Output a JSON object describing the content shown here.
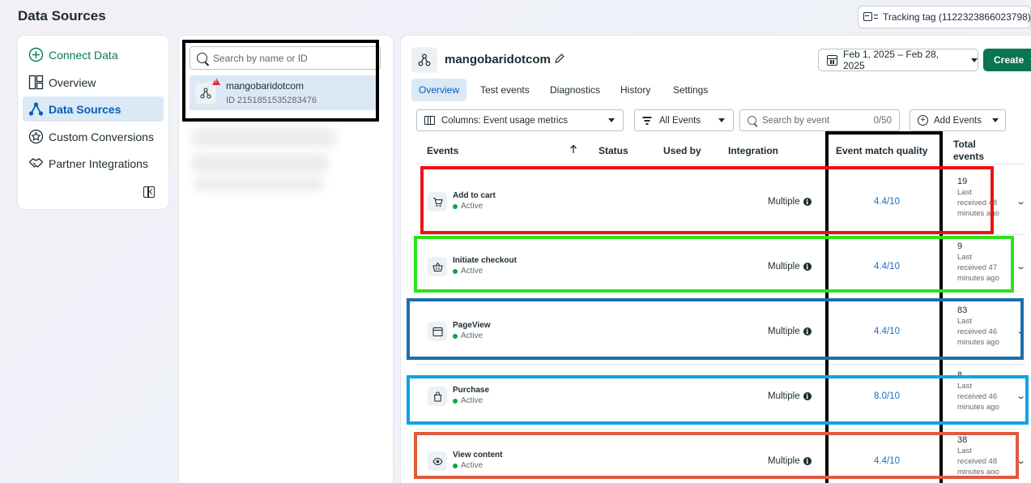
{
  "page": {
    "title": "Data Sources"
  },
  "tracking_tag": {
    "label": "Tracking tag (1122323866023798)"
  },
  "nav": {
    "items": [
      {
        "label": "Connect Data",
        "icon": "plus-circle-icon"
      },
      {
        "label": "Overview",
        "icon": "overview-grid-icon"
      },
      {
        "label": "Data Sources",
        "icon": "data-sources-icon",
        "selected": true
      },
      {
        "label": "Custom Conversions",
        "icon": "star-badge-icon"
      },
      {
        "label": "Partner Integrations",
        "icon": "handshake-icon"
      }
    ]
  },
  "source_list": {
    "search_placeholder": "Search by name or ID",
    "items": [
      {
        "name": "mangobaridotcom",
        "id": "ID 2151851535283476",
        "warning": true
      }
    ]
  },
  "main": {
    "title": "mangobaridotcom",
    "date_range": "Feb 1, 2025 – Feb 28, 2025",
    "create_label": "Create",
    "tabs": [
      "Overview",
      "Test events",
      "Diagnostics",
      "History",
      "Settings"
    ],
    "active_tab": "Overview",
    "filters": {
      "columns": "Columns: Event usage metrics",
      "events": "All Events",
      "search_placeholder": "Search by event",
      "search_count": "0/50",
      "add_events": "Add Events"
    },
    "table": {
      "headers": {
        "events": "Events",
        "status": "Status",
        "used_by": "Used by",
        "integration": "Integration",
        "emq": "Event match quality",
        "total": "Total events"
      },
      "rows": [
        {
          "name": "Add to cart",
          "status": "Active",
          "integration": "Multiple",
          "emq": "4.4/10",
          "total": "19",
          "last": "Last received 48 minutes ago",
          "icon": "cart-icon"
        },
        {
          "name": "Initiate checkout",
          "status": "Active",
          "integration": "Multiple",
          "emq": "4.4/10",
          "total": "9",
          "last": "Last received 47 minutes ago",
          "icon": "basket-icon"
        },
        {
          "name": "PageView",
          "status": "Active",
          "integration": "Multiple",
          "emq": "4.4/10",
          "total": "83",
          "last": "Last received 46 minutes ago",
          "icon": "browser-window-icon"
        },
        {
          "name": "Purchase",
          "status": "Active",
          "integration": "Multiple",
          "emq": "8.0/10",
          "total": "8",
          "last": "Last received 46 minutes ago",
          "icon": "shopping-bag-icon"
        },
        {
          "name": "View content",
          "status": "Active",
          "integration": "Multiple",
          "emq": "4.4/10",
          "total": "38",
          "last": "Last received 48 minutes ago",
          "icon": "eye-icon"
        }
      ]
    }
  },
  "annotations": {
    "colors": [
      "#000000",
      "#ee1111",
      "#2de21b",
      "#1a6fb0",
      "#0ea4e8",
      "#e15a3c"
    ]
  }
}
